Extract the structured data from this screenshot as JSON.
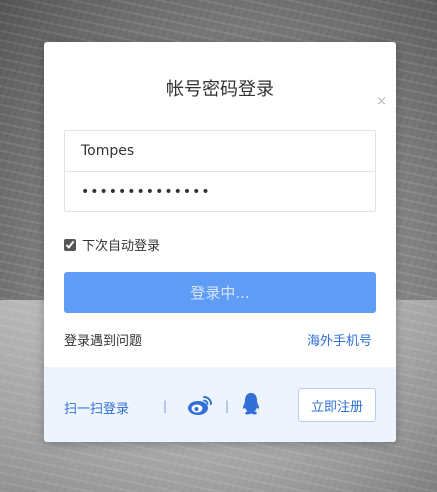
{
  "dialog": {
    "title": "帐号密码登录"
  },
  "form": {
    "username_value": "Tompes",
    "password_value": "••••••••••••••",
    "clear_glyph": "×",
    "remember_label": "下次自动登录",
    "remember_checked": true,
    "login_button_label": "登录中..."
  },
  "links": {
    "problem": "登录遇到问题",
    "overseas": "海外手机号"
  },
  "footer": {
    "scan_label": "扫一扫登录",
    "separator": "|",
    "weibo_icon": "weibo-icon",
    "qq_icon": "qq-icon",
    "register_label": "立即注册"
  },
  "colors": {
    "accent": "#5f9cf6",
    "link": "#2f6fd6",
    "footer_bg": "#eef4fd"
  }
}
